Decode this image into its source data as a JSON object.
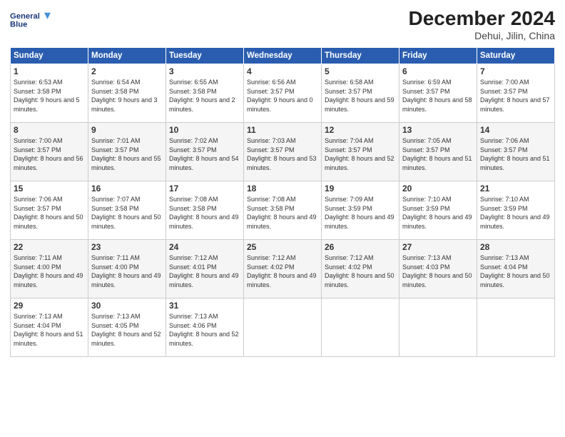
{
  "logo": {
    "line1": "General",
    "line2": "Blue"
  },
  "title": "December 2024",
  "subtitle": "Dehui, Jilin, China",
  "days_header": [
    "Sunday",
    "Monday",
    "Tuesday",
    "Wednesday",
    "Thursday",
    "Friday",
    "Saturday"
  ],
  "weeks": [
    [
      {
        "day": "1",
        "sunrise": "Sunrise: 6:53 AM",
        "sunset": "Sunset: 3:58 PM",
        "daylight": "Daylight: 9 hours and 5 minutes."
      },
      {
        "day": "2",
        "sunrise": "Sunrise: 6:54 AM",
        "sunset": "Sunset: 3:58 PM",
        "daylight": "Daylight: 9 hours and 3 minutes."
      },
      {
        "day": "3",
        "sunrise": "Sunrise: 6:55 AM",
        "sunset": "Sunset: 3:58 PM",
        "daylight": "Daylight: 9 hours and 2 minutes."
      },
      {
        "day": "4",
        "sunrise": "Sunrise: 6:56 AM",
        "sunset": "Sunset: 3:57 PM",
        "daylight": "Daylight: 9 hours and 0 minutes."
      },
      {
        "day": "5",
        "sunrise": "Sunrise: 6:58 AM",
        "sunset": "Sunset: 3:57 PM",
        "daylight": "Daylight: 8 hours and 59 minutes."
      },
      {
        "day": "6",
        "sunrise": "Sunrise: 6:59 AM",
        "sunset": "Sunset: 3:57 PM",
        "daylight": "Daylight: 8 hours and 58 minutes."
      },
      {
        "day": "7",
        "sunrise": "Sunrise: 7:00 AM",
        "sunset": "Sunset: 3:57 PM",
        "daylight": "Daylight: 8 hours and 57 minutes."
      }
    ],
    [
      {
        "day": "8",
        "sunrise": "Sunrise: 7:00 AM",
        "sunset": "Sunset: 3:57 PM",
        "daylight": "Daylight: 8 hours and 56 minutes."
      },
      {
        "day": "9",
        "sunrise": "Sunrise: 7:01 AM",
        "sunset": "Sunset: 3:57 PM",
        "daylight": "Daylight: 8 hours and 55 minutes."
      },
      {
        "day": "10",
        "sunrise": "Sunrise: 7:02 AM",
        "sunset": "Sunset: 3:57 PM",
        "daylight": "Daylight: 8 hours and 54 minutes."
      },
      {
        "day": "11",
        "sunrise": "Sunrise: 7:03 AM",
        "sunset": "Sunset: 3:57 PM",
        "daylight": "Daylight: 8 hours and 53 minutes."
      },
      {
        "day": "12",
        "sunrise": "Sunrise: 7:04 AM",
        "sunset": "Sunset: 3:57 PM",
        "daylight": "Daylight: 8 hours and 52 minutes."
      },
      {
        "day": "13",
        "sunrise": "Sunrise: 7:05 AM",
        "sunset": "Sunset: 3:57 PM",
        "daylight": "Daylight: 8 hours and 51 minutes."
      },
      {
        "day": "14",
        "sunrise": "Sunrise: 7:06 AM",
        "sunset": "Sunset: 3:57 PM",
        "daylight": "Daylight: 8 hours and 51 minutes."
      }
    ],
    [
      {
        "day": "15",
        "sunrise": "Sunrise: 7:06 AM",
        "sunset": "Sunset: 3:57 PM",
        "daylight": "Daylight: 8 hours and 50 minutes."
      },
      {
        "day": "16",
        "sunrise": "Sunrise: 7:07 AM",
        "sunset": "Sunset: 3:58 PM",
        "daylight": "Daylight: 8 hours and 50 minutes."
      },
      {
        "day": "17",
        "sunrise": "Sunrise: 7:08 AM",
        "sunset": "Sunset: 3:58 PM",
        "daylight": "Daylight: 8 hours and 49 minutes."
      },
      {
        "day": "18",
        "sunrise": "Sunrise: 7:08 AM",
        "sunset": "Sunset: 3:58 PM",
        "daylight": "Daylight: 8 hours and 49 minutes."
      },
      {
        "day": "19",
        "sunrise": "Sunrise: 7:09 AM",
        "sunset": "Sunset: 3:59 PM",
        "daylight": "Daylight: 8 hours and 49 minutes."
      },
      {
        "day": "20",
        "sunrise": "Sunrise: 7:10 AM",
        "sunset": "Sunset: 3:59 PM",
        "daylight": "Daylight: 8 hours and 49 minutes."
      },
      {
        "day": "21",
        "sunrise": "Sunrise: 7:10 AM",
        "sunset": "Sunset: 3:59 PM",
        "daylight": "Daylight: 8 hours and 49 minutes."
      }
    ],
    [
      {
        "day": "22",
        "sunrise": "Sunrise: 7:11 AM",
        "sunset": "Sunset: 4:00 PM",
        "daylight": "Daylight: 8 hours and 49 minutes."
      },
      {
        "day": "23",
        "sunrise": "Sunrise: 7:11 AM",
        "sunset": "Sunset: 4:00 PM",
        "daylight": "Daylight: 8 hours and 49 minutes."
      },
      {
        "day": "24",
        "sunrise": "Sunrise: 7:12 AM",
        "sunset": "Sunset: 4:01 PM",
        "daylight": "Daylight: 8 hours and 49 minutes."
      },
      {
        "day": "25",
        "sunrise": "Sunrise: 7:12 AM",
        "sunset": "Sunset: 4:02 PM",
        "daylight": "Daylight: 8 hours and 49 minutes."
      },
      {
        "day": "26",
        "sunrise": "Sunrise: 7:12 AM",
        "sunset": "Sunset: 4:02 PM",
        "daylight": "Daylight: 8 hours and 50 minutes."
      },
      {
        "day": "27",
        "sunrise": "Sunrise: 7:13 AM",
        "sunset": "Sunset: 4:03 PM",
        "daylight": "Daylight: 8 hours and 50 minutes."
      },
      {
        "day": "28",
        "sunrise": "Sunrise: 7:13 AM",
        "sunset": "Sunset: 4:04 PM",
        "daylight": "Daylight: 8 hours and 50 minutes."
      }
    ],
    [
      {
        "day": "29",
        "sunrise": "Sunrise: 7:13 AM",
        "sunset": "Sunset: 4:04 PM",
        "daylight": "Daylight: 8 hours and 51 minutes."
      },
      {
        "day": "30",
        "sunrise": "Sunrise: 7:13 AM",
        "sunset": "Sunset: 4:05 PM",
        "daylight": "Daylight: 8 hours and 52 minutes."
      },
      {
        "day": "31",
        "sunrise": "Sunrise: 7:13 AM",
        "sunset": "Sunset: 4:06 PM",
        "daylight": "Daylight: 8 hours and 52 minutes."
      },
      null,
      null,
      null,
      null
    ]
  ]
}
